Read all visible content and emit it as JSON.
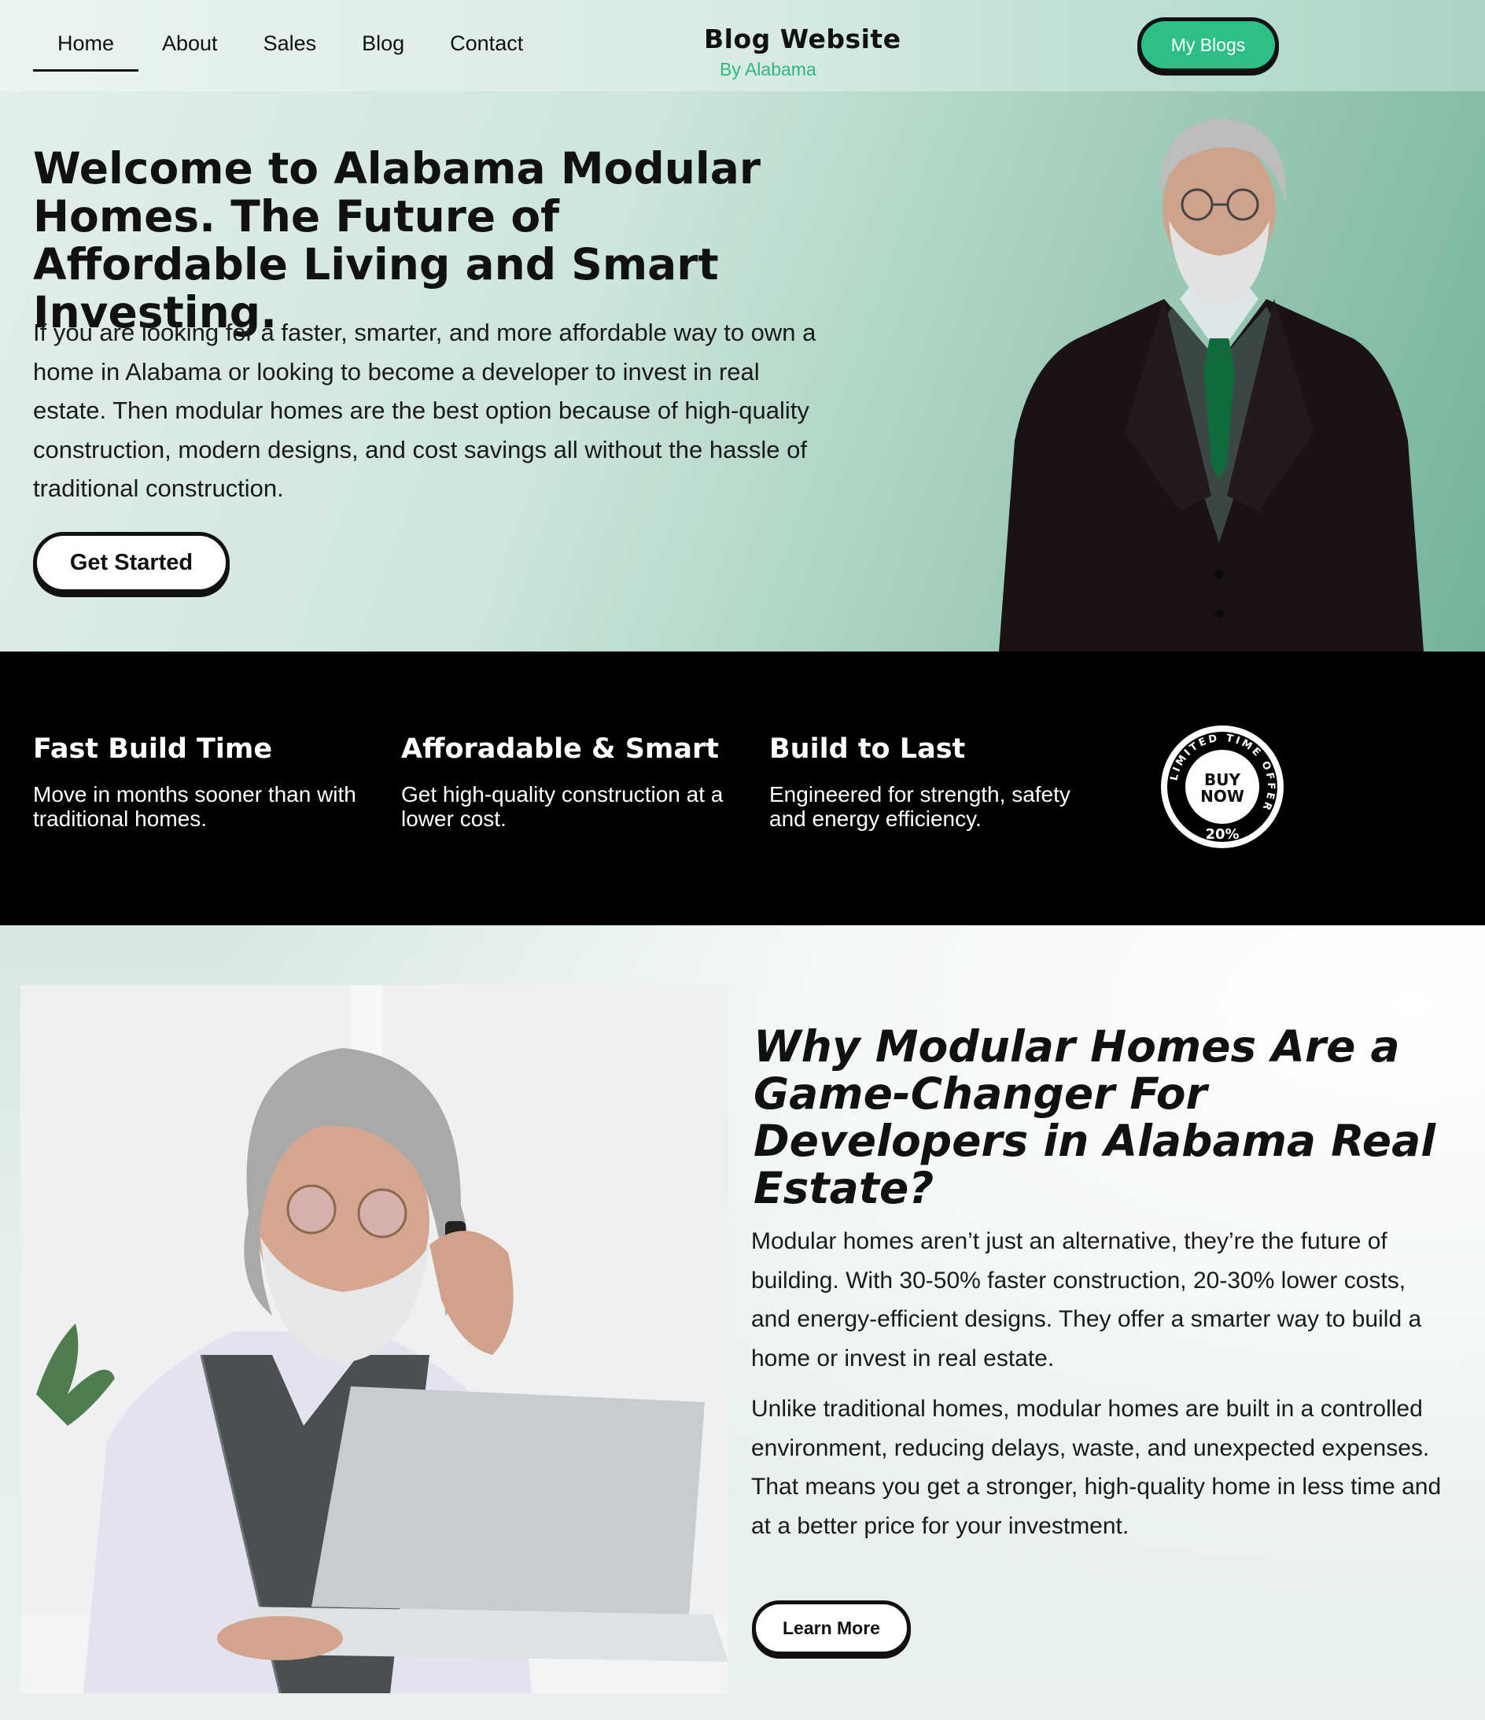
{
  "nav": {
    "items": [
      {
        "label": "Home",
        "active": true
      },
      {
        "label": "About"
      },
      {
        "label": "Sales"
      },
      {
        "label": "Blog"
      },
      {
        "label": "Contact"
      }
    ]
  },
  "brand": {
    "title": "Blog Website",
    "subtitle": "By Alabama"
  },
  "header": {
    "my_blogs_label": "My Blogs"
  },
  "hero": {
    "title": "Welcome to Alabama Modular Homes. The Future of Affordable Living and Smart Investing.",
    "text": "If you are looking for a faster, smarter, and more affordable way to own a home in Alabama or looking to become a developer to invest in real estate. Then modular homes are the best option because of high-quality construction, modern designs, and cost savings all without the hassle of traditional construction.",
    "cta_label": "Get Started"
  },
  "features": [
    {
      "title": "Fast Build Time",
      "text": "Move in months sooner than with traditional homes."
    },
    {
      "title": "Afforadable & Smart",
      "text": "Get high-quality construction at a lower cost."
    },
    {
      "title": "Build to Last",
      "text": "Engineered for strength, safety and energy efficiency."
    }
  ],
  "badge": {
    "ring_text": "LIMITED TIME OFFER",
    "line1": "BUY",
    "line2": "NOW",
    "discount": "20%"
  },
  "why": {
    "title": "Why Modular Homes Are a Game-Changer For Developers in Alabama Real Estate?",
    "paragraph1": "Modular homes aren’t just an alternative, they’re the future of building. With 30-50% faster construction, 20-30% lower costs, and energy-efficient designs. They offer a smarter way to build a home or invest in real estate.",
    "paragraph2": "Unlike traditional homes, modular homes are built in a controlled environment, reducing delays, waste, and unexpected expenses. That means you get a stronger, high-quality home in less time and at a better price for your investment.",
    "cta_label": "Learn More"
  },
  "colors": {
    "accent": "#2cbf86",
    "brand_sub": "#2fb783",
    "band": "#000000"
  }
}
